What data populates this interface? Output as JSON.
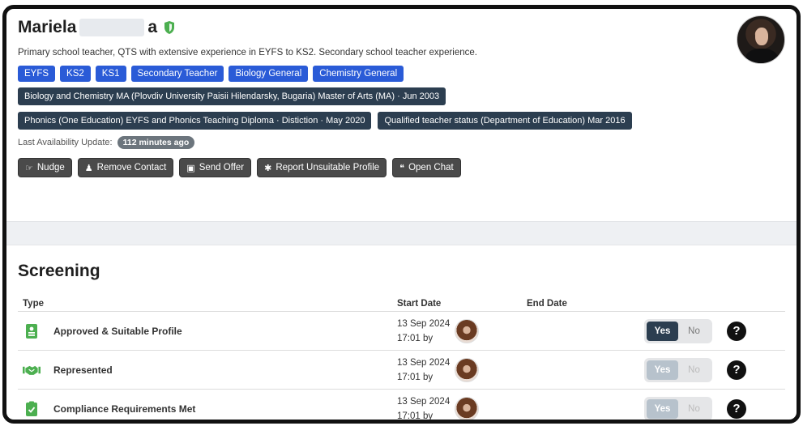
{
  "profile": {
    "name_first": "Mariela",
    "name_last_end": "a",
    "summary": "Primary school teacher, QTS with extensive experience in EYFS to KS2. Secondary school teacher experience.",
    "tags": [
      "EYFS",
      "KS2",
      "KS1",
      "Secondary Teacher",
      "Biology General",
      "Chemistry General"
    ],
    "qualifications_row1": [
      "Biology and Chemistry MA (Plovdiv University Paisii Hilendarsky, Bugaria) Master of Arts (MA) · Jun 2003"
    ],
    "qualifications_row2": [
      "Phonics (One Education) EYFS and Phonics Teaching Diploma · Distiction · May 2020",
      "Qualified teacher status (Department of Education) Mar 2016"
    ],
    "availability_label": "Last Availability Update:",
    "availability_value": "112 minutes ago",
    "actions": {
      "nudge": "Nudge",
      "remove_contact": "Remove Contact",
      "send_offer": "Send Offer",
      "report": "Report Unsuitable Profile",
      "open_chat": "Open Chat"
    },
    "icons": {
      "verified": "shield-icon",
      "nudge": "hand-pointer-icon",
      "remove": "user-remove-icon",
      "offer": "briefcase-icon",
      "report": "bug-icon",
      "chat": "chat-icon"
    },
    "colors": {
      "tag_blue": "#2a5bd7",
      "qual_dark": "#2c3e50",
      "button_gray": "#4a4a4a",
      "shield_green": "#4caf50"
    }
  },
  "screening": {
    "title": "Screening",
    "headers": {
      "type": "Type",
      "start": "Start Date",
      "end": "End Date"
    },
    "rows": [
      {
        "type": "Approved & Suitable Profile",
        "icon": "id-badge-icon",
        "start_date": "13 Sep 2024",
        "start_time": "17:01 by",
        "yes": "Yes",
        "no": "No",
        "selected": "Yes",
        "help": "?"
      },
      {
        "type": "Represented",
        "icon": "handshake-icon",
        "start_date": "13 Sep 2024",
        "start_time": "17:01 by",
        "yes": "Yes",
        "no": "No",
        "selected": "none",
        "help": "?"
      },
      {
        "type": "Compliance Requirements Met",
        "icon": "clipboard-check-icon",
        "start_date": "13 Sep 2024",
        "start_time": "17:01 by",
        "yes": "Yes",
        "no": "No",
        "selected": "none",
        "help": "?"
      }
    ]
  }
}
